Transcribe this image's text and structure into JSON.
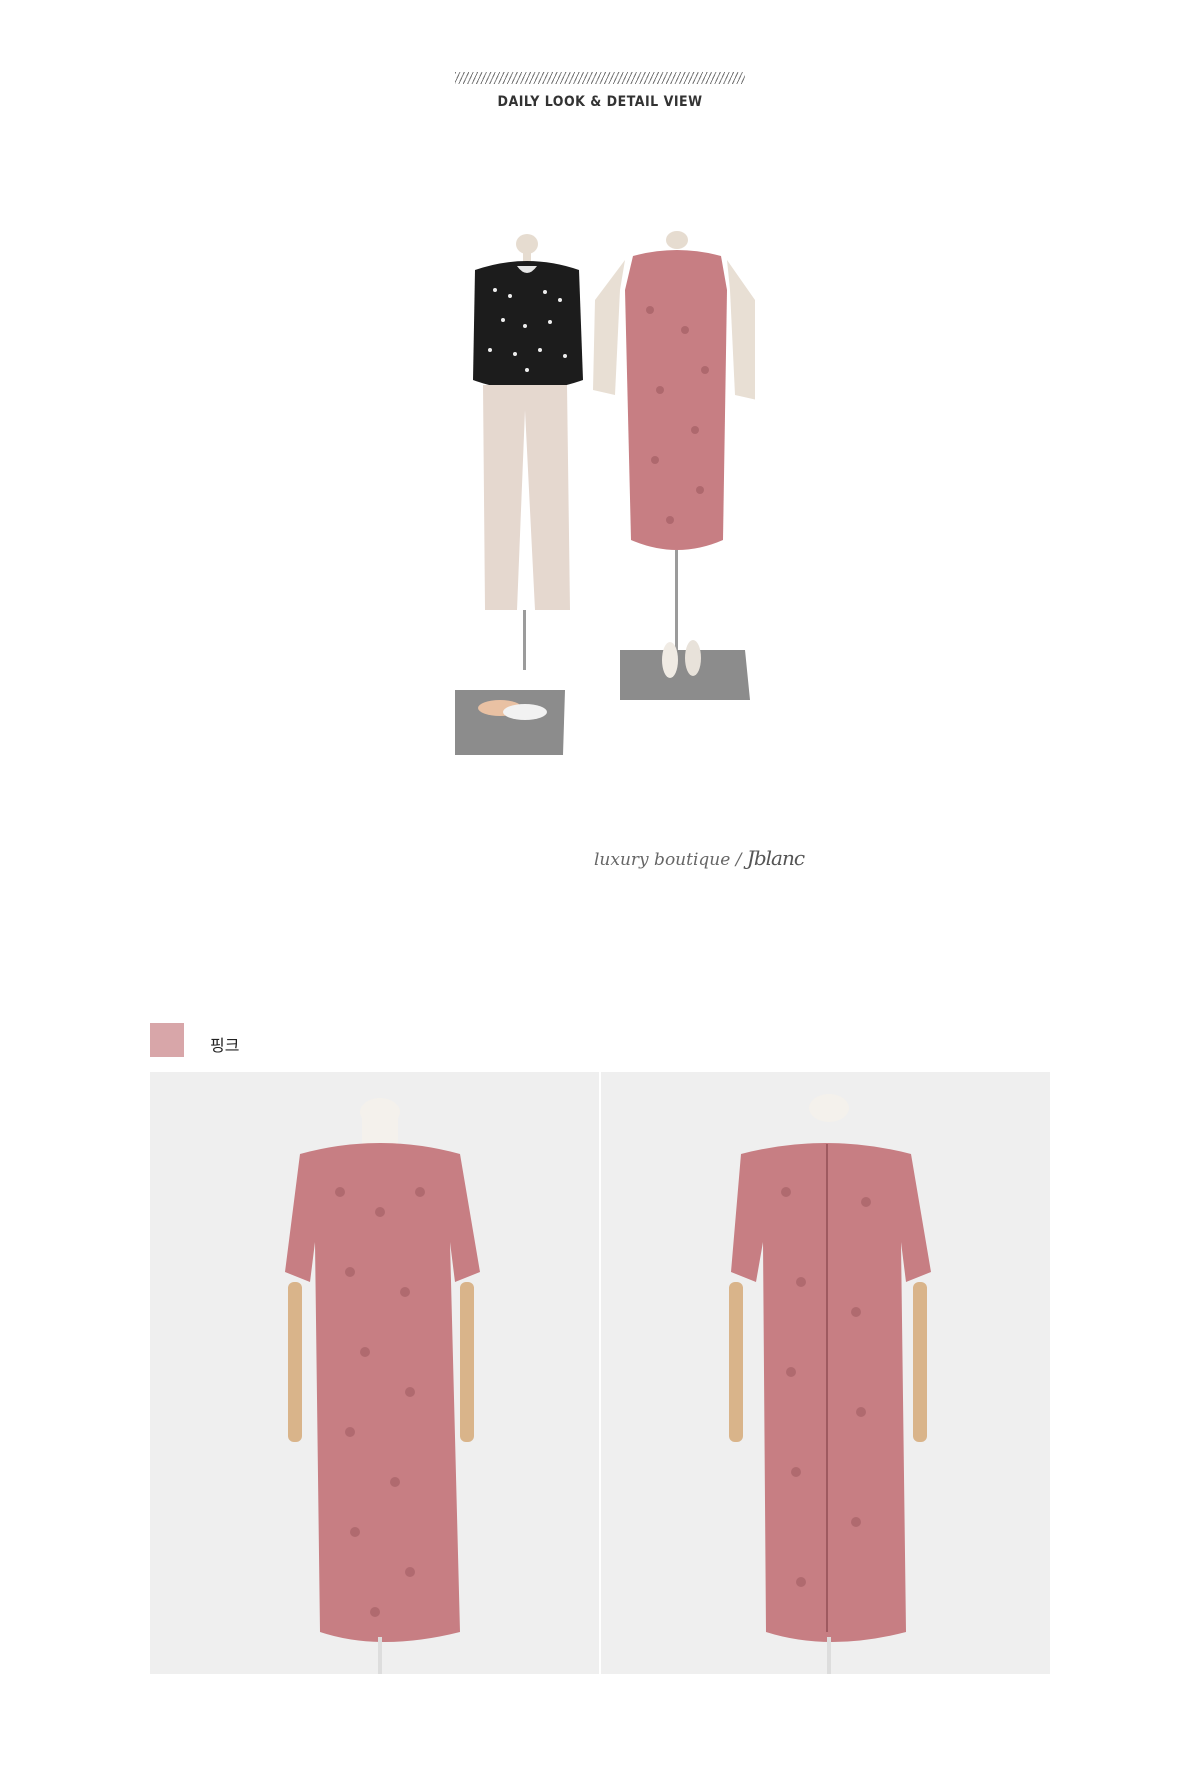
{
  "header": {
    "title": "DAILY LOOK & DETAIL VIEW"
  },
  "signature": {
    "text": "luxury boutique",
    "separator": "/",
    "brand_script": "Jblanc"
  },
  "color_option": {
    "label": "핑크",
    "swatch_color": "#d8a6a9"
  },
  "colors": {
    "dress_pink": "#c77e83",
    "lace_dark": "#9f5a60",
    "panel_bg": "#efefef",
    "jacket": "#e8dfd4",
    "sweater": "#1c1c1c",
    "pants": "#e5d8cf"
  },
  "images": {
    "look": "styled-mannequins-image",
    "front": "pink-lace-dress-front-image",
    "back": "pink-lace-dress-back-image"
  }
}
